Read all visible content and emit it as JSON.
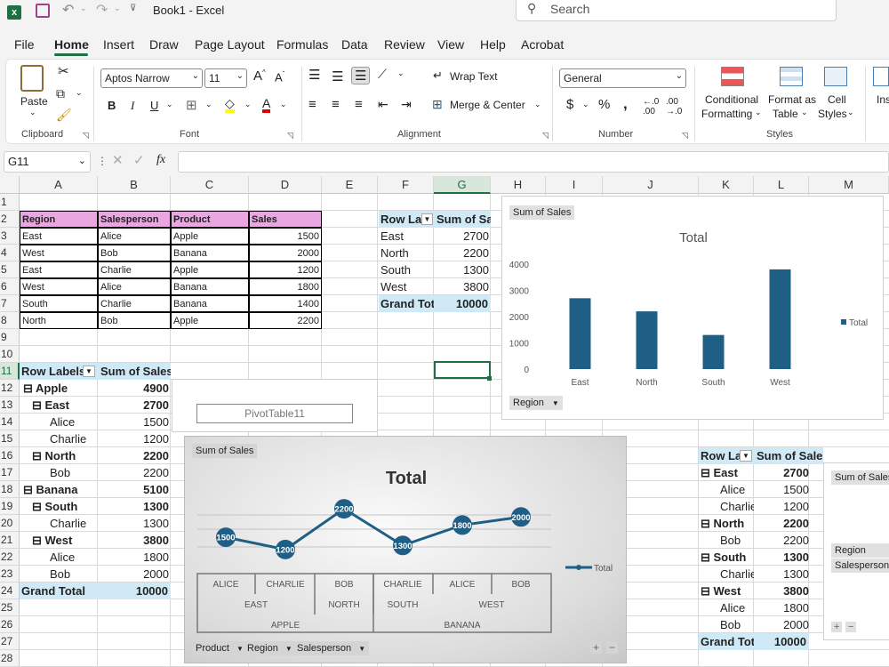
{
  "titlebar": {
    "title": "Book1 - Excel",
    "search_placeholder": "Search"
  },
  "menu": [
    "File",
    "Home",
    "Insert",
    "Draw",
    "Page Layout",
    "Formulas",
    "Data",
    "Review",
    "View",
    "Help",
    "Acrobat"
  ],
  "ribbon": {
    "paste": "Paste",
    "clipboard": "Clipboard",
    "font_name": "Aptos Narrow",
    "font_size": "11",
    "font": "Font",
    "wrap_text": "Wrap Text",
    "merge_center": "Merge & Center",
    "alignment": "Alignment",
    "number_format": "General",
    "number": "Number",
    "conditional": "Conditional",
    "formatting": "Formatting",
    "format_as": "Format as",
    "table": "Table",
    "cell": "Cell",
    "styles_btn": "Styles",
    "styles": "Styles",
    "insert": "Ins"
  },
  "formula": {
    "name_box": "G11",
    "fx": "fx",
    "value": ""
  },
  "columns": [
    "A",
    "B",
    "C",
    "D",
    "E",
    "F",
    "G",
    "H",
    "I",
    "J",
    "K",
    "L",
    "M"
  ],
  "rows": [
    "1",
    "2",
    "3",
    "4",
    "5",
    "6",
    "7",
    "8",
    "9",
    "10",
    "11",
    "12",
    "13",
    "14",
    "15",
    "16",
    "17",
    "18",
    "19",
    "20",
    "21",
    "22",
    "23",
    "24",
    "25",
    "26",
    "27",
    "28"
  ],
  "table": {
    "headers": [
      "Region",
      "Salesperson",
      "Product",
      "Sales"
    ],
    "rows": [
      [
        "East",
        "Alice",
        "Apple",
        "1500"
      ],
      [
        "West",
        "Bob",
        "Banana",
        "2000"
      ],
      [
        "East",
        "Charlie",
        "Apple",
        "1200"
      ],
      [
        "West",
        "Alice",
        "Banana",
        "1800"
      ],
      [
        "South",
        "Charlie",
        "Banana",
        "1400"
      ],
      [
        "North",
        "Bob",
        "Apple",
        "2200"
      ]
    ]
  },
  "pivot1": {
    "header": [
      "Row Lab",
      "Sum of Sales"
    ],
    "rows": [
      [
        "East",
        "2700"
      ],
      [
        "North",
        "2200"
      ],
      [
        "South",
        "1300"
      ],
      [
        "West",
        "3800"
      ]
    ],
    "total": [
      "Grand Tota",
      "10000"
    ]
  },
  "pivot2": {
    "header": [
      "Row Labels",
      "Sum of Sales"
    ],
    "rows": [
      [
        "⊟ Apple",
        "4900",
        0,
        true
      ],
      [
        "⊟ East",
        "2700",
        1,
        true
      ],
      [
        "Alice",
        "1500",
        2,
        false
      ],
      [
        "Charlie",
        "1200",
        2,
        false
      ],
      [
        "⊟ North",
        "2200",
        1,
        true
      ],
      [
        "Bob",
        "2200",
        2,
        false
      ],
      [
        "⊟ Banana",
        "5100",
        0,
        true
      ],
      [
        "⊟ South",
        "1300",
        1,
        true
      ],
      [
        "Charlie",
        "1300",
        2,
        false
      ],
      [
        "⊟ West",
        "3800",
        1,
        true
      ],
      [
        "Alice",
        "1800",
        2,
        false
      ],
      [
        "Bob",
        "2000",
        2,
        false
      ]
    ],
    "total": [
      "Grand Total",
      "10000"
    ],
    "placeholder": "PivotTable11"
  },
  "pivot3": {
    "header": [
      "Row Lal",
      "Sum of Sales"
    ],
    "rows": [
      [
        "⊟ East",
        "2700",
        true
      ],
      [
        "Alice",
        "1500",
        false
      ],
      [
        "Charlie",
        "1200",
        false
      ],
      [
        "⊟ North",
        "2200",
        true
      ],
      [
        "Bob",
        "2200",
        false
      ],
      [
        "⊟ South",
        "1300",
        true
      ],
      [
        "Charlie",
        "1300",
        false
      ],
      [
        "⊟ West",
        "3800",
        true
      ],
      [
        "Alice",
        "1800",
        false
      ],
      [
        "Bob",
        "2000",
        false
      ]
    ],
    "total": [
      "Grand Tota",
      "10000"
    ]
  },
  "chart_data": [
    {
      "type": "bar",
      "title": "Total",
      "categories": [
        "East",
        "North",
        "South",
        "West"
      ],
      "series": [
        {
          "name": "Total",
          "values": [
            2700,
            2200,
            1300,
            3800
          ]
        }
      ],
      "ylim": [
        0,
        4000
      ],
      "yticks": [
        "0",
        "1000",
        "2000",
        "3000",
        "4000"
      ],
      "legend": "right",
      "field_button": "Sum of Sales",
      "axis_button": "Region",
      "color": "#1f5f85"
    },
    {
      "type": "line",
      "title": "Total",
      "categories": [
        "ALICE",
        "CHARLIE",
        "BOB",
        "CHARLIE",
        "ALICE",
        "BOB"
      ],
      "category_groups": [
        [
          "EAST",
          "NORTH",
          "SOUTH",
          "WEST"
        ],
        [
          "APPLE",
          "BANANA"
        ]
      ],
      "series": [
        {
          "name": "Total",
          "values": [
            1500,
            1200,
            2200,
            1300,
            1800,
            2000
          ]
        }
      ],
      "legend": "right",
      "field_button": "Sum of Sales",
      "axis_buttons": [
        "Product",
        "Region",
        "Salesperson"
      ],
      "color": "#1f5f85"
    }
  ],
  "chart3": {
    "field_button": "Sum of Sales",
    "region": "Region",
    "salesperson": "Salesperson"
  }
}
